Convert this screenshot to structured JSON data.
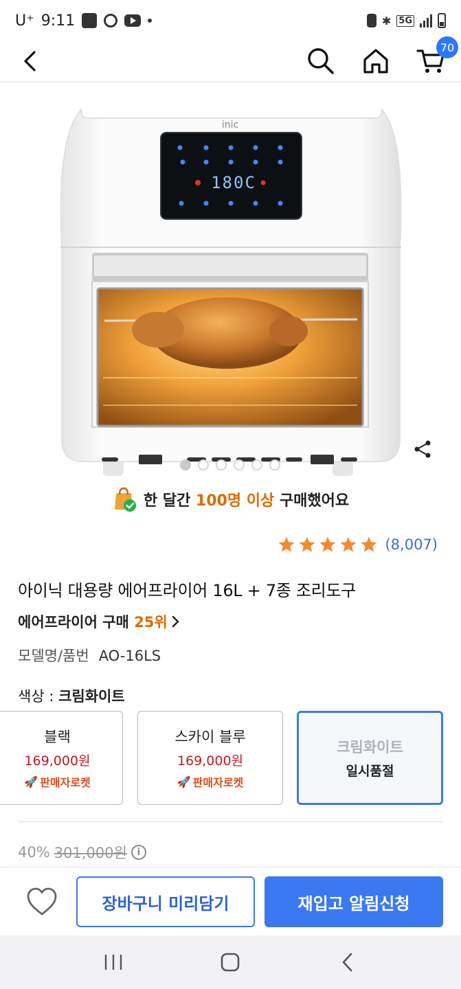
{
  "status_bar": {
    "carrier": "U⁺",
    "time": "9:11",
    "network": "5G"
  },
  "nav": {
    "cart_count": "70"
  },
  "banner": {
    "prefix": "한 달간 ",
    "highlight": "100명 이상",
    "suffix": " 구매했어요"
  },
  "product": {
    "display_logo": "inic",
    "display_temp": "180C",
    "rating": 5,
    "review_count": "(8,007)",
    "title": "아이닉 대용량 에어프라이어 16L + 7종 조리도구",
    "rank_prefix": "에어프라이어 구매 ",
    "rank": "25위",
    "model_label": "모델명/품번",
    "model_value": "AO-16LS",
    "color_label": "색상 : ",
    "color_selected": "크림화이트"
  },
  "options": [
    {
      "name": "블랙",
      "price": "169,000원",
      "badge": "판매자로켓"
    },
    {
      "name": "스카이 블루",
      "price": "169,000원",
      "badge": "판매자로켓"
    },
    {
      "name": "크림화이트",
      "status": "일시품절"
    }
  ],
  "pricing": {
    "discount": "40%",
    "original_price": "301,000원"
  },
  "actions": {
    "cart_label": "장바구니 미리담기",
    "restock_label": "재입고 알림신청"
  },
  "colors": {
    "accent": "#3a79f0",
    "highlight": "#e06a00",
    "price": "#c21b1b",
    "star": "#f28a2e"
  }
}
